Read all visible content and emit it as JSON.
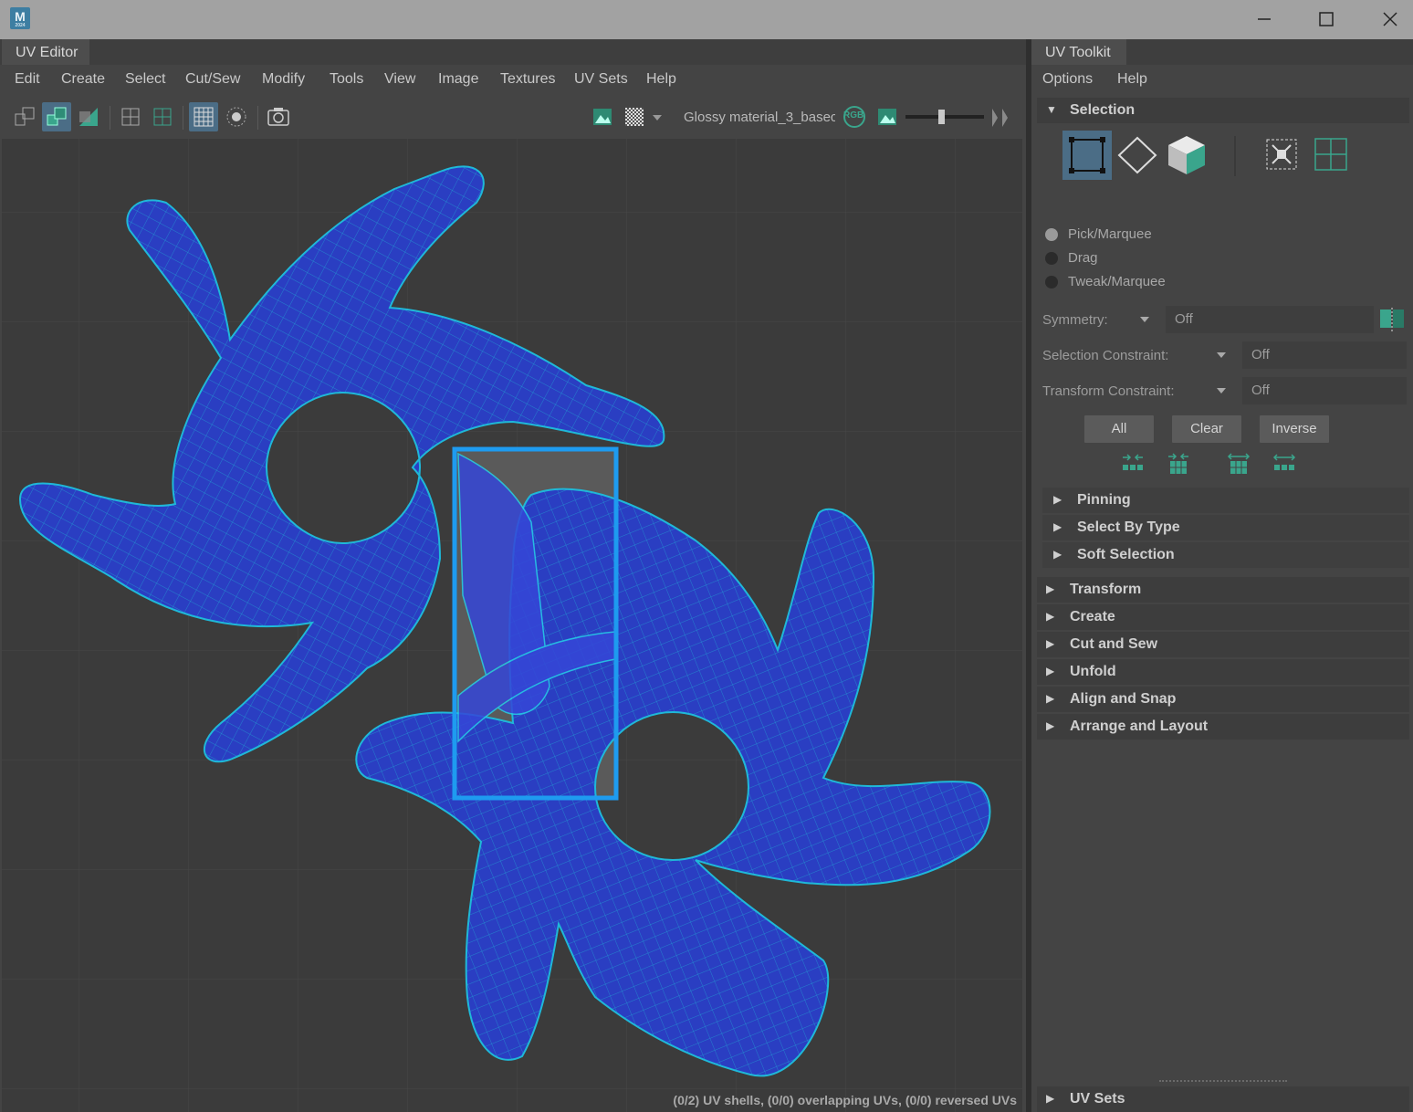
{
  "window": {
    "app_icon_letter": "M",
    "app_icon_sub": "2024"
  },
  "uv_editor": {
    "tab_title": "UV Editor",
    "menu": [
      "Edit",
      "Create",
      "Select",
      "Cut/Sew",
      "Modify",
      "Tools",
      "View",
      "Image",
      "Textures",
      "UV Sets",
      "Help"
    ],
    "toolbar": {
      "material_name": "Glossy material_3_basec",
      "rgb_label": "RGB"
    },
    "status": "(0/2) UV shells, (0/0) overlapping UVs, (0/0) reversed UVs"
  },
  "uv_toolkit": {
    "tab_title": "UV Toolkit",
    "menu": [
      "Options",
      "Help"
    ],
    "selection": {
      "title": "Selection",
      "modes": [
        "Pick/Marquee",
        "Drag",
        "Tweak/Marquee"
      ],
      "selected_mode": "Pick/Marquee",
      "symmetry_label": "Symmetry:",
      "symmetry_value": "Off",
      "selection_constraint_label": "Selection Constraint:",
      "selection_constraint_value": "Off",
      "transform_constraint_label": "Transform Constraint:",
      "transform_constraint_value": "Off",
      "buttons": [
        "All",
        "Clear",
        "Inverse"
      ],
      "subsections": [
        "Pinning",
        "Select By Type",
        "Soft Selection"
      ]
    },
    "sections": [
      "Transform",
      "Create",
      "Cut and Sew",
      "Unfold",
      "Align and Snap",
      "Arrange and Layout"
    ],
    "uv_sets": "UV Sets"
  },
  "colors": {
    "uv_shell_fill": "#2a3ec2",
    "uv_wire": "#1fb8d8",
    "selection_rect": "#1e9bf0",
    "active_tool": "#4b6d86",
    "accent_green": "#3aa58c"
  }
}
